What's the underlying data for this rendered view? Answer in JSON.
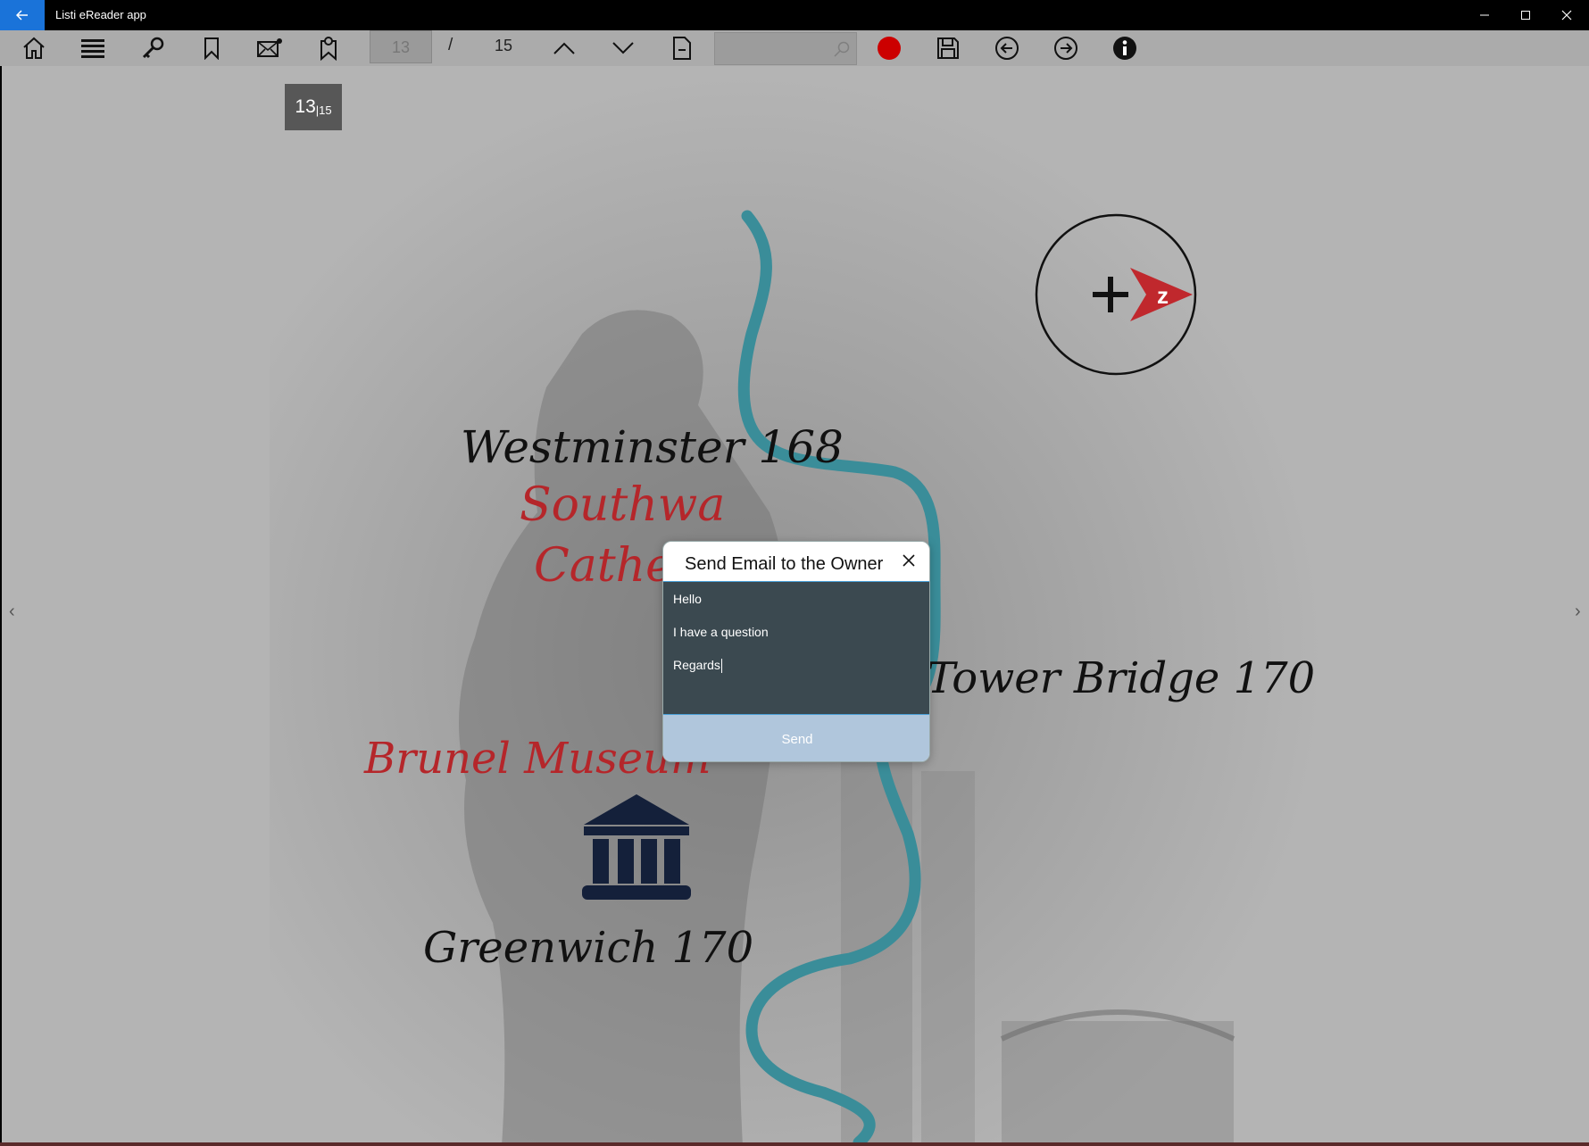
{
  "app": {
    "title": "Listi eReader app"
  },
  "toolbar": {
    "icons": [
      "home-icon",
      "menu-icon",
      "key-icon",
      "bookmark-icon",
      "send-email-icon",
      "bookmark-location-icon",
      "page-up-icon",
      "page-down-icon",
      "page-icon",
      "search-icon",
      "record-icon",
      "save-icon",
      "back-icon",
      "forward-icon",
      "info-icon"
    ],
    "page_number": "13",
    "page_separator": "/",
    "page_total": "15",
    "search_placeholder": "",
    "record_color": "#cc0000"
  },
  "page": {
    "badge_current": "13",
    "badge_total": "|15",
    "labels": {
      "westminster": "Westminster 168",
      "southwark_1": "Southwa",
      "southwark_2": "Cathedr",
      "tower_bridge": "Tower Bridge 170",
      "brunel": "Brunel Museum",
      "greenwich": "Greenwich 170"
    },
    "colors": {
      "river": "#3a8d99",
      "red_text": "#b5262a",
      "dark_text": "#111111",
      "museum_icon": "#14203a"
    }
  },
  "dialog": {
    "title": "Send Email to the Owner",
    "lines": [
      "Hello",
      "I have a question",
      "Regards"
    ],
    "send_label": "Send"
  },
  "nav": {
    "prev": "‹",
    "next": "›"
  }
}
